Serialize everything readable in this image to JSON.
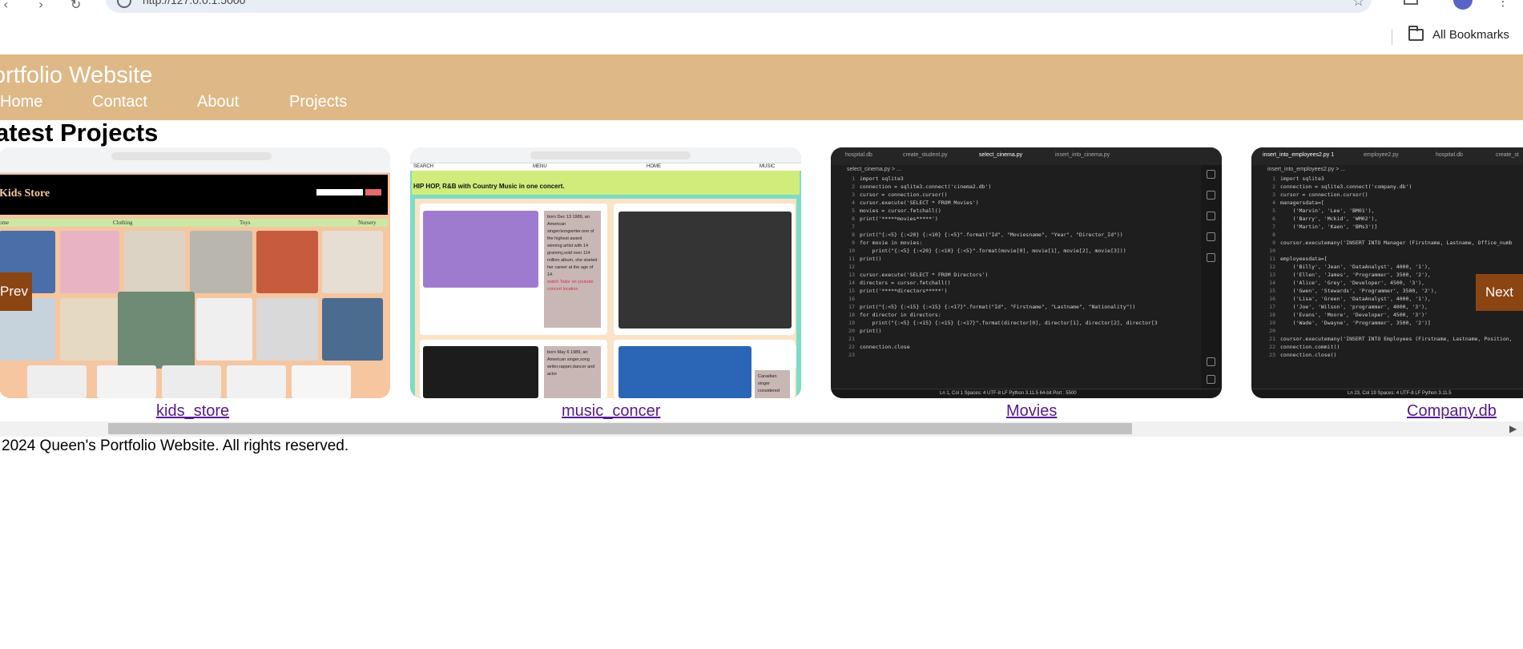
{
  "browser": {
    "url": "http://127.0.0.1:5000",
    "bookmarks_label": "All Bookmarks"
  },
  "header": {
    "title": "ortfolio Website",
    "nav": [
      "Home",
      "Contact",
      "About",
      "Projects"
    ]
  },
  "section_title": "atest Projects",
  "carousel": {
    "prev_label": "Prev",
    "next_label": "Next",
    "projects": [
      {
        "caption": "kids_store"
      },
      {
        "caption": "music_concer"
      },
      {
        "caption": "Movies"
      },
      {
        "caption": "Company.db"
      }
    ]
  },
  "kids_store_shot": {
    "title": "Kids Store",
    "menu": [
      "ome",
      "Clothing",
      "Toys",
      "Nursery"
    ]
  },
  "music_shot": {
    "nav": [
      "SEARCH",
      "MENU",
      "HOME",
      "MUSIC"
    ],
    "banner": "HIP HOP, R&B with Country Music in one concert.",
    "note1": "born Dec 13 1989, an American singer/songwriter.one of the highest award winning artist with 14 grammy,sold over 114 million album, she started her career at the age of 14.",
    "note1_link": "watch Tailor on youtube concert location",
    "note2": "born May 6 1989, an American singer,song writer,rapper,dancer and actor",
    "note3": "Canadian singer considered"
  },
  "movies_shot": {
    "tabs": [
      "hospital.db",
      "create_student.py",
      "select_cinema.py",
      "insert_into_cinema.py"
    ],
    "crumb": "select_cinema.py > ...",
    "lines": "import sqlite3\nconnection = sqlite3.connect('cinema2.db')\ncursor = connection.cursor()\ncursor.execute('SELECT * FROM Movies')\nmovies = cursor.fetchall()\nprint('*****movies*****')\n\nprint(\"{:<5} {:<20} {:<10} {:<5}\".format(\"Id\", \"Moviesname\", \"Year\", \"Director_Id\"))\nfor movie in movies:\n    print(\"{:<5} {:<20} {:<10} {:<5}\".format(movie[0], movie[1], movie[2], movie[3]))\nprint()\n\ncursor.execute('SELECT * FROM Directors')\ndirectors = cursor.fetchall()\nprint('*****directors*****')\n\nprint(\"{:<5} {:<15} {:<15} {:<17}\".format(\"Id\", \"Firstname\", \"Lastname\", \"Nationality\"))\nfor director in directors:\n    print(\"{:<5} {:<15} {:<15} {:<17}\".format(director[0], director[1], director[2], director[3\nprint()\n\nconnection.close\n",
    "status": "Ln 1, Col 1   Spaces: 4   UTF-8   LF   Python   3.11.5 64-bit   Port : 5500"
  },
  "company_shot": {
    "tabs": [
      "insert_into_employees2.py 1",
      "employee2.py",
      "hospital.db",
      "create_st"
    ],
    "crumb": "insert_into_employees2.py > ...",
    "lines": "import sqlite3\nconnection = sqlite3.connect('company.db')\ncursor = connection.cursor()\nmanagersdata=[\n    ('Marvin', 'Lee', 'BM01'),\n    ('Barry', 'Mckid', 'WM02'),\n    ('Martin', 'Kaen', 'BMs3')]\n\ncoursor.executemany('INSERT INTO Manager (Firstname, Lastname, Office_numb\n\nemployeesdata=[\n    ('Billy', 'Jean', 'DataAnalyst', 4000, '1'),\n    ('Ellen', 'James', 'Programmer', 3500, '2'),\n    ('Alice', 'Grey', 'Developer', 4500, '3'),\n    ('Gwen', 'Stewards', 'Programmer', 3500, '2'),\n    ('Lisa', 'Green', 'DataAnalyst', 4000, '1'),\n    ('Joe', 'Wilson', 'programmer', 4000, '3'),\n    ('Evans', 'Moore', 'Developer', 4500, '3')'\n    ('Wade', 'Dwayne', 'Programmer', 3500, '2')]\n\ncoursor.executemany('INSERT INTO Employees (Firstname, Lastname, Position,\nconnection.commit()\nconnection.close()",
    "status": "Ln 23, Col 19   Spaces: 4   UTF-8   LF   Python   3.11.5"
  },
  "footer": "2024 Queen's Portfolio Website. All rights reserved."
}
